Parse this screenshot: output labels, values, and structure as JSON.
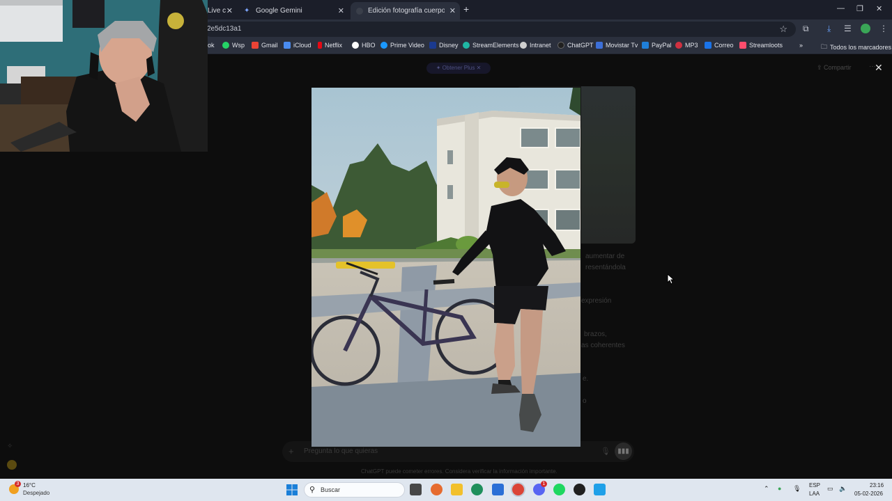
{
  "browser": {
    "tabs": [
      {
        "label": "Live c",
        "active": false
      },
      {
        "label": "Google Gemini",
        "active": false
      },
      {
        "label": "Edición fotografía cuerpo obes",
        "active": true
      }
    ],
    "url": "2e5dc13a1",
    "bookmarks": [
      "ok",
      "Wsp",
      "Gmail",
      "iCloud",
      "Netflix",
      "HBO",
      "Prime Video",
      "Disney",
      "StreamElements",
      "Intranet",
      "ChatGPT",
      "Movistar Tv",
      "PayPal",
      "MP3",
      "Correo",
      "Streamloots"
    ],
    "bookmark_colors": [
      "#888888",
      "#25d366",
      "#ea4335",
      "#4a8cf0",
      "#e50914",
      "#ffffff",
      "#1a98ff",
      "#1b3a8f",
      "#1fb7a4",
      "#cfcfcf",
      "#202020",
      "#3c6fd8",
      "#1f7fd8",
      "#d03040",
      "#1a73e8",
      "#ff4d6d"
    ],
    "all_bookmarks": "Todos los marcadores"
  },
  "chat": {
    "upgrade_label": "Obtener Plus",
    "share_label": "Compartir",
    "ghost_lines": [
      "aumentar de",
      "resentándola",
      "expresión",
      "brazos,",
      "as coherentes",
      "e.",
      "o"
    ],
    "input_placeholder": "Pregunta lo que quieras",
    "disclaimer": "ChatGPT puede cometer errores. Considera verificar la información importante."
  },
  "taskbar": {
    "temperature": "16°C",
    "condition": "Despejado",
    "weather_badge": "3",
    "search_label": "Buscar",
    "lang_top": "ESP",
    "lang_bottom": "LAA",
    "time": "23:16",
    "date": "05-02-2026",
    "discord_badge": "1",
    "app_colors": [
      "#474747",
      "#e66b2f",
      "#f2c02c",
      "#1f8f5c",
      "#2b6fd6",
      "#db4437",
      "#5865f2",
      "#1ed760",
      "#202020",
      "#1fa0e8"
    ]
  }
}
